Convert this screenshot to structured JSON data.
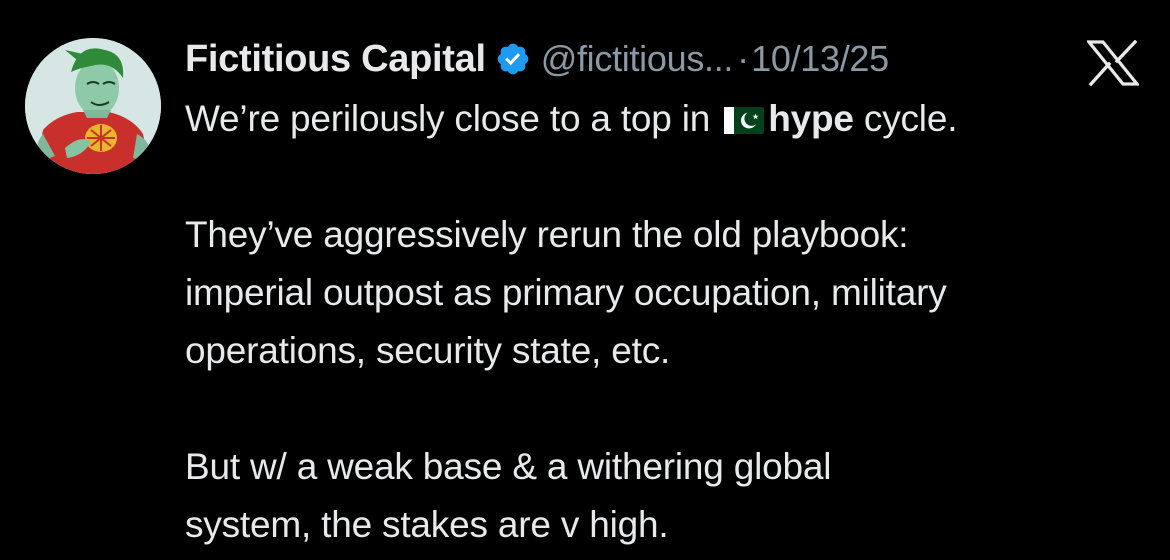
{
  "tweet": {
    "author": {
      "display_name": "Fictitious Capital",
      "handle": "@fictitious...",
      "verified": true,
      "verified_icon": "verified-badge-icon",
      "verified_color": "#1d9bf0",
      "avatar": "cartoon-superhero-avatar"
    },
    "separator": "·",
    "timestamp": "10/13/25",
    "platform_icon": "x-logo-icon",
    "text": {
      "line1_before": "We’re perilously close to a top in",
      "line1_emoji": "pakistan-flag-emoji",
      "line1_bold": "hype",
      "line1_after": "cycle.",
      "para2_line1": "They’ve aggressively rerun the old playbook:",
      "para2_line2": "imperial outpost as primary occupation, military",
      "para2_line3": "operations, security state, etc.",
      "para3_line1": "But w/ a weak base & a withering global",
      "para3_line2": "system, the stakes are v high."
    }
  },
  "colors": {
    "background": "#000000",
    "primary_text": "#e7e9ea",
    "secondary_text": "#8b98a5",
    "verified": "#1d9bf0"
  }
}
